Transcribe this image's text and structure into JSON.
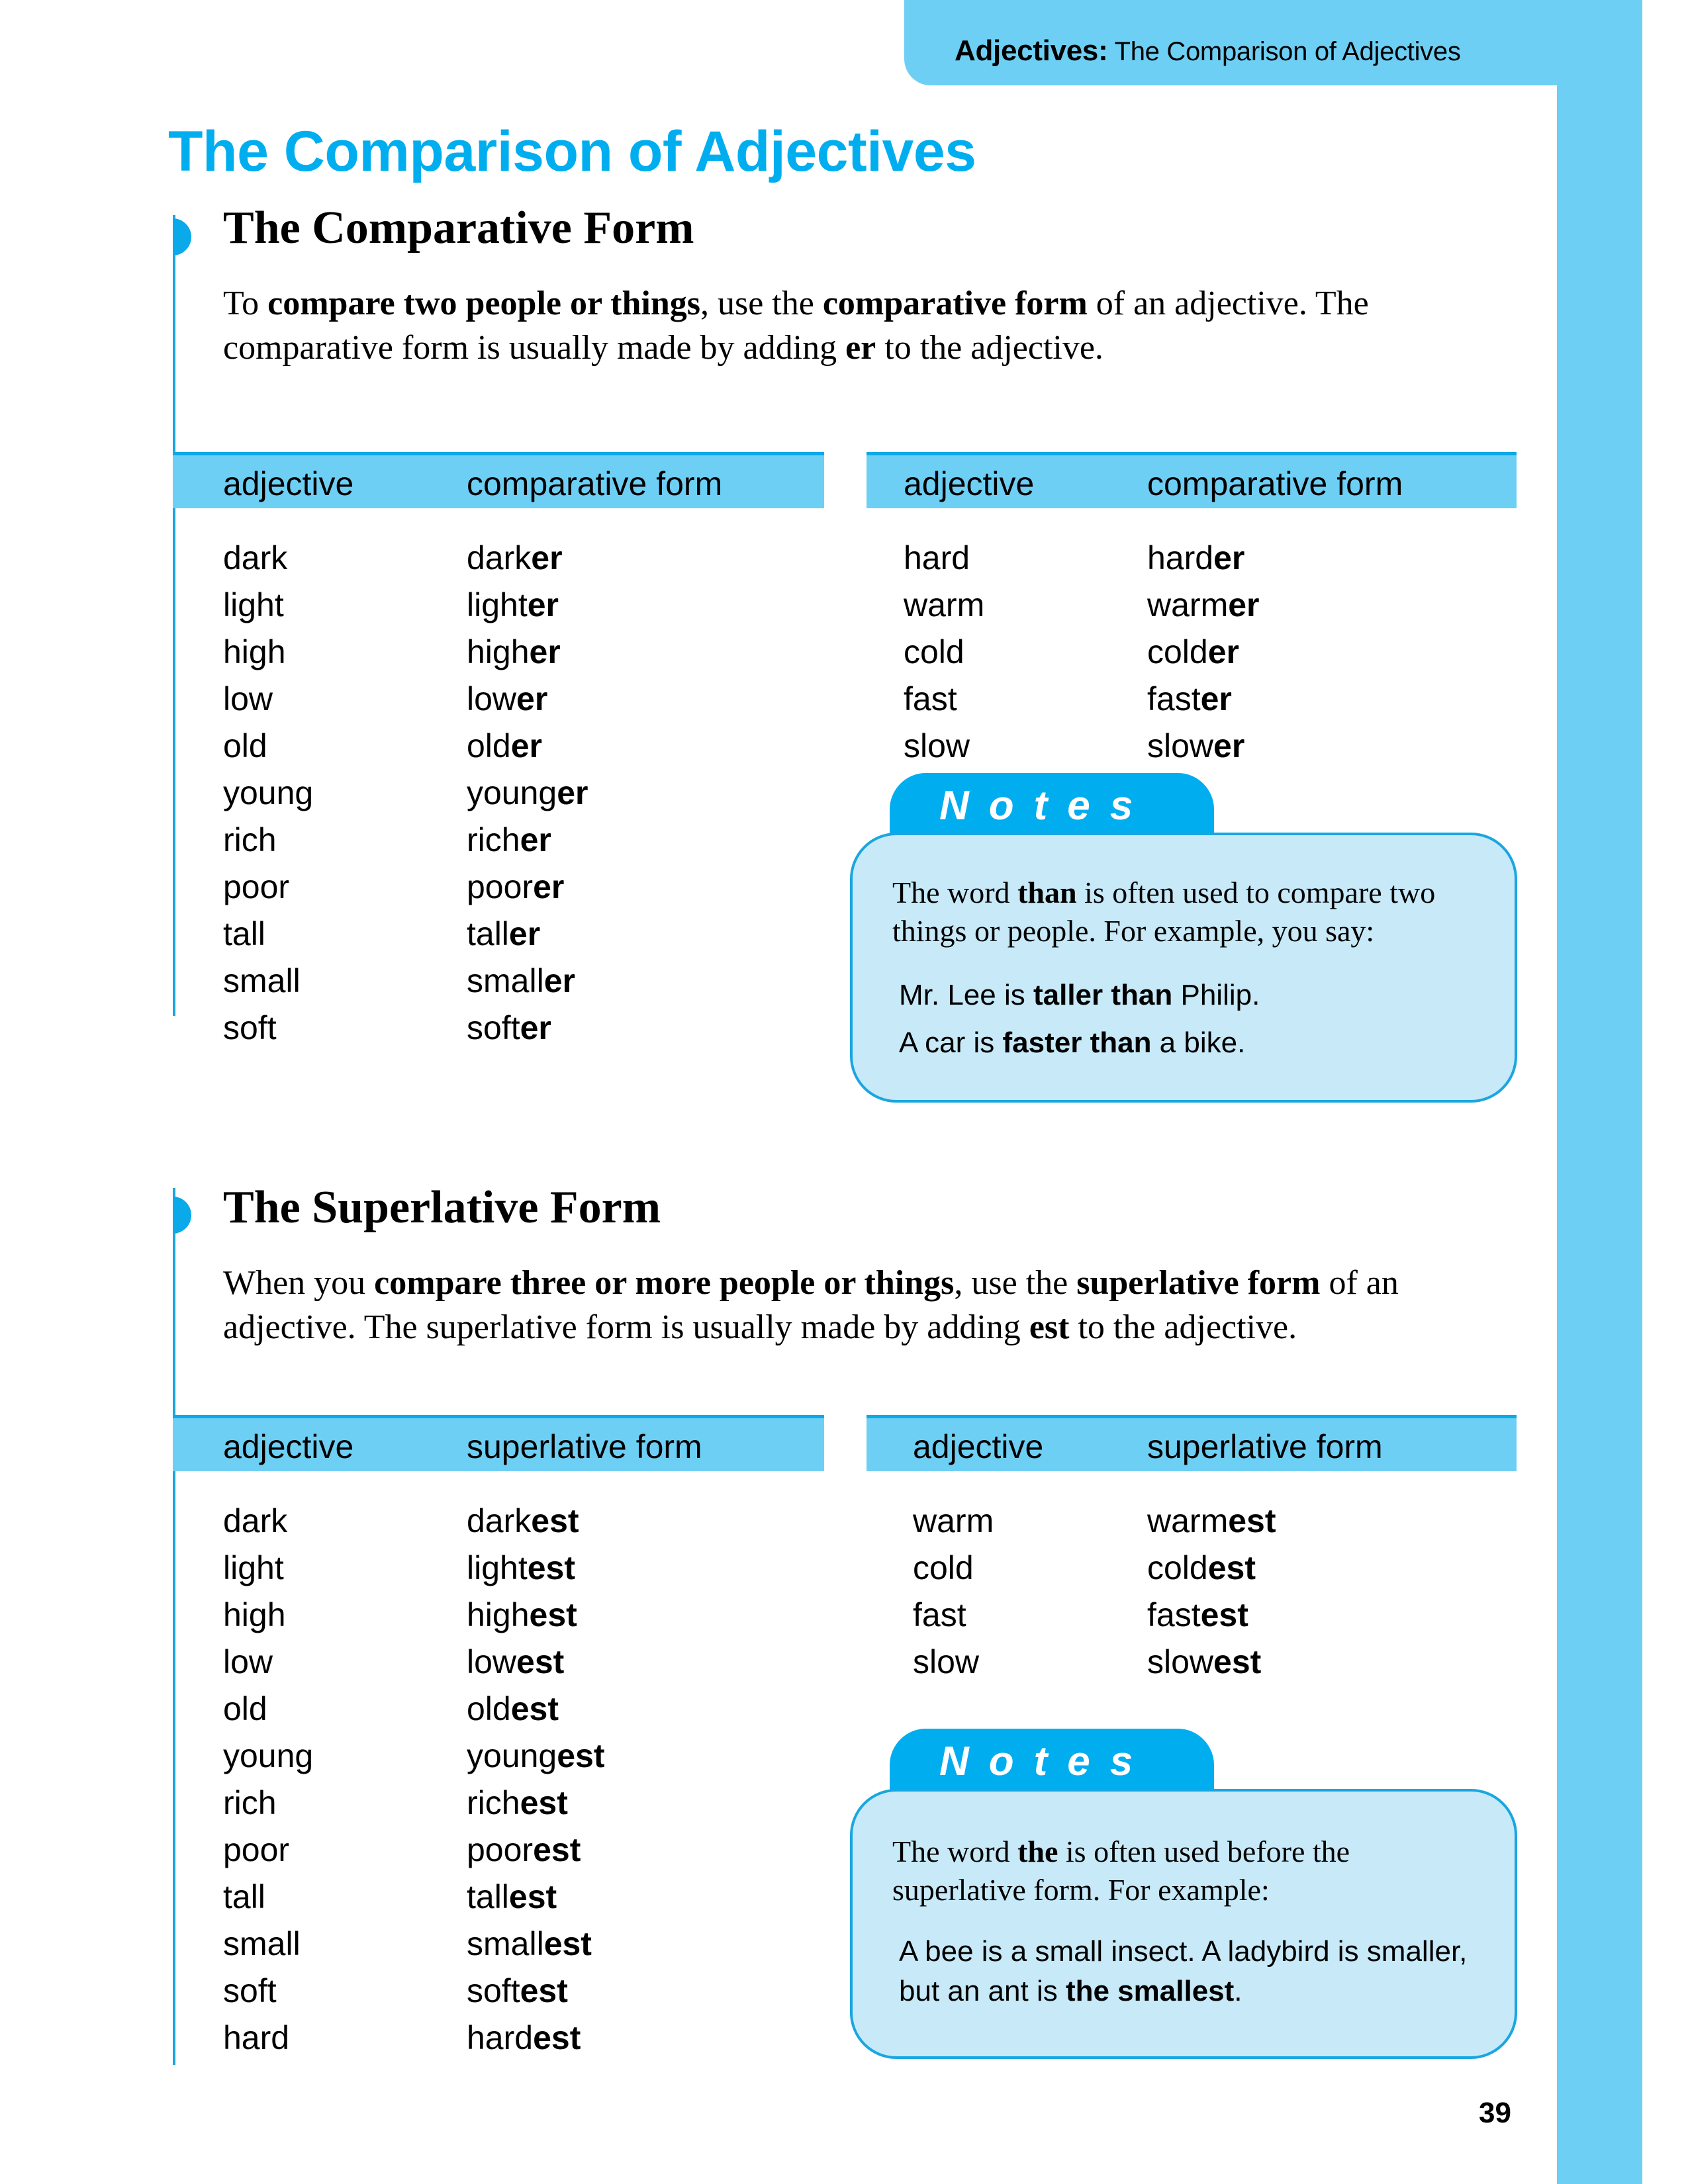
{
  "header": {
    "section_label": "Adjectives:",
    "running_title": "The Comparison of Adjectives"
  },
  "page_title": "The Comparison of Adjectives",
  "comparative": {
    "heading": "The Comparative Form",
    "intro_parts": [
      {
        "text": "To ",
        "bold": false
      },
      {
        "text": "compare two people or things",
        "bold": true
      },
      {
        "text": ", use the ",
        "bold": false
      },
      {
        "text": "comparative form",
        "bold": true
      },
      {
        "text": " of an adjective. The comparative form is usually made by adding ",
        "bold": false
      },
      {
        "text": "er",
        "bold": true
      },
      {
        "text": " to the adjective.",
        "bold": false
      }
    ],
    "table_left": {
      "col1": "adjective",
      "col2": "comparative form",
      "rows": [
        {
          "adjective": "dark",
          "stem": "dark",
          "suffix": "er"
        },
        {
          "adjective": "light",
          "stem": "light",
          "suffix": "er"
        },
        {
          "adjective": "high",
          "stem": "high",
          "suffix": "er"
        },
        {
          "adjective": "low",
          "stem": "low",
          "suffix": "er"
        },
        {
          "adjective": "old",
          "stem": "old",
          "suffix": "er"
        },
        {
          "adjective": "young",
          "stem": "young",
          "suffix": "er"
        },
        {
          "adjective": "rich",
          "stem": "rich",
          "suffix": "er"
        },
        {
          "adjective": "poor",
          "stem": "poor",
          "suffix": "er"
        },
        {
          "adjective": "tall",
          "stem": "tall",
          "suffix": "er"
        },
        {
          "adjective": "small",
          "stem": "small",
          "suffix": "er"
        },
        {
          "adjective": "soft",
          "stem": "soft",
          "suffix": "er"
        }
      ]
    },
    "table_right": {
      "col1": "adjective",
      "col2": "comparative form",
      "rows": [
        {
          "adjective": "hard",
          "stem": "hard",
          "suffix": "er"
        },
        {
          "adjective": "warm",
          "stem": "warm",
          "suffix": "er"
        },
        {
          "adjective": "cold",
          "stem": "cold",
          "suffix": "er"
        },
        {
          "adjective": "fast",
          "stem": "fast",
          "suffix": "er"
        },
        {
          "adjective": "slow",
          "stem": "slow",
          "suffix": "er"
        }
      ]
    },
    "notes": {
      "tab_label": "Notes",
      "text_parts": [
        {
          "text": "The word ",
          "bold": false
        },
        {
          "text": "than",
          "bold": true
        },
        {
          "text": " is often used to compare two things or people. For example, you say:",
          "bold": false
        }
      ],
      "examples": [
        [
          {
            "text": "Mr. Lee is ",
            "bold": false
          },
          {
            "text": "taller than",
            "bold": true
          },
          {
            "text": " Philip.",
            "bold": false
          }
        ],
        [
          {
            "text": "A car is ",
            "bold": false
          },
          {
            "text": "faster than",
            "bold": true
          },
          {
            "text": " a bike.",
            "bold": false
          }
        ]
      ]
    }
  },
  "superlative": {
    "heading": "The Superlative Form",
    "intro_parts": [
      {
        "text": "When you ",
        "bold": false
      },
      {
        "text": "compare three or more people or things",
        "bold": true
      },
      {
        "text": ", use the ",
        "bold": false
      },
      {
        "text": "superlative form",
        "bold": true
      },
      {
        "text": " of an adjective. The superlative form is usually made by adding ",
        "bold": false
      },
      {
        "text": "est",
        "bold": true
      },
      {
        "text": " to the adjective.",
        "bold": false
      }
    ],
    "table_left": {
      "col1": "adjective",
      "col2": "superlative form",
      "rows": [
        {
          "adjective": "dark",
          "stem": "dark",
          "suffix": "est"
        },
        {
          "adjective": "light",
          "stem": "light",
          "suffix": "est"
        },
        {
          "adjective": "high",
          "stem": "high",
          "suffix": "est"
        },
        {
          "adjective": "low",
          "stem": "low",
          "suffix": "est"
        },
        {
          "adjective": "old",
          "stem": "old",
          "suffix": "est"
        },
        {
          "adjective": "young",
          "stem": "young",
          "suffix": "est"
        },
        {
          "adjective": "rich",
          "stem": "rich",
          "suffix": "est"
        },
        {
          "adjective": "poor",
          "stem": "poor",
          "suffix": "est"
        },
        {
          "adjective": "tall",
          "stem": "tall",
          "suffix": "est"
        },
        {
          "adjective": "small",
          "stem": "small",
          "suffix": "est"
        },
        {
          "adjective": "soft",
          "stem": "soft",
          "suffix": "est"
        },
        {
          "adjective": "hard",
          "stem": "hard",
          "suffix": "est"
        }
      ]
    },
    "table_right": {
      "col1": "adjective",
      "col2": "superlative form",
      "rows": [
        {
          "adjective": "warm",
          "stem": "warm",
          "suffix": "est"
        },
        {
          "adjective": "cold",
          "stem": "cold",
          "suffix": "est"
        },
        {
          "adjective": "fast",
          "stem": "fast",
          "suffix": "est"
        },
        {
          "adjective": "slow",
          "stem": "slow",
          "suffix": "est"
        }
      ]
    },
    "notes": {
      "tab_label": "Notes",
      "text_parts": [
        {
          "text": "The word ",
          "bold": false
        },
        {
          "text": "the",
          "bold": true
        },
        {
          "text": " is often used before the superlative form. For example:",
          "bold": false
        }
      ],
      "examples": [
        [
          {
            "text": "A bee is a small insect. A ladybird is smaller, but an ant is ",
            "bold": false
          },
          {
            "text": "the smallest",
            "bold": true
          },
          {
            "text": ".",
            "bold": false
          }
        ]
      ]
    }
  },
  "page_number": "39",
  "colors": {
    "accent": "#00aeef",
    "band": "#6ecff5",
    "notes_fill": "#c7e9f8",
    "notes_tab": "#00adef"
  }
}
